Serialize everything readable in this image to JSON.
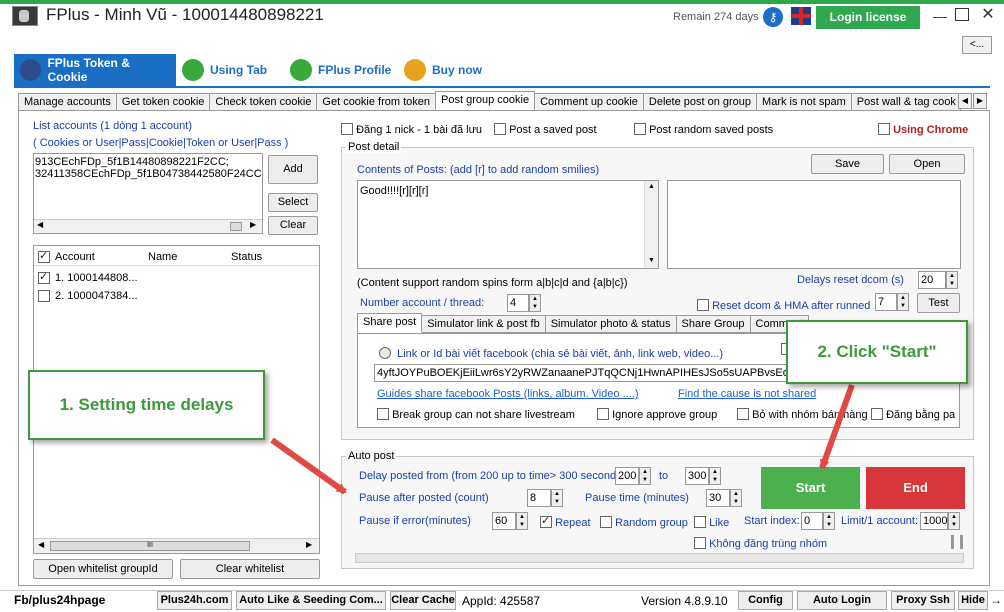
{
  "window": {
    "title": "FPlus - Minh Vũ - 100014480898221",
    "remain": "Remain 274 days",
    "login_label": "Login license",
    "back_label": "<..."
  },
  "main_tabs": [
    {
      "label": "FPlus Token & Cookie"
    },
    {
      "label": "Using Tab"
    },
    {
      "label": "FPlus Profile"
    },
    {
      "label": "Buy now"
    }
  ],
  "sub_tabs": [
    "Manage accounts",
    "Get token cookie",
    "Check token cookie",
    "Get cookie from token",
    "Post group cookie",
    "Comment up cookie",
    "Delete post on group",
    "Mark is not spam",
    "Post wall & tag cook"
  ],
  "left": {
    "list_title": "List accounts (1 dòng 1 account)",
    "list_hint": "( Cookies or User|Pass|Cookie|Token or User|Pass )",
    "cookie_lines": [
      "913CEchFDp_5f1B14480898221F2CC;",
      "32411358CEchFDp_5f1B04738442580F24CC;"
    ],
    "add_label": "Add",
    "select_label": "Select",
    "clear_label": "Clear",
    "columns": [
      "Account",
      "Name",
      "Status"
    ],
    "rows": [
      {
        "account": "1. 1000144808...",
        "checked": true
      },
      {
        "account": "2. 1000047384...",
        "checked": false
      }
    ],
    "whitelist_label": "Open whitelist groupId",
    "clear_whitelist_label": "Clear whitelist"
  },
  "options": {
    "one_nick": "Đăng 1 nick - 1 bài đã lưu",
    "saved_post": "Post a saved post",
    "random_saved": "Post random saved posts",
    "using_chrome": "Using Chrome"
  },
  "post_detail": {
    "label": "Post detail",
    "contents_label": "Contents of Posts: (add [r] to add random smilies)",
    "save_label": "Save",
    "open_label": "Open",
    "content_text": "Good!!!![r][r][r]",
    "spin_hint": "(Content support random spins form a|b|c|d and {a|b|c})",
    "delays_reset_label": "Delays reset dcom (s)",
    "delays_reset_value": "20",
    "number_account_label": "Number account / thread:",
    "number_account_value": "4",
    "reset_dcom_label": "Reset dcom & HMA after runned",
    "reset_dcom_value": "7",
    "test_label": "Test"
  },
  "inner_tabs": [
    "Share post",
    "Simulator link & post fb",
    "Simulator photo & status",
    "Share Group",
    "Comment"
  ],
  "share": {
    "link_label": "Link or Id bài viết facebook (chia sẻ bài viết, ảnh, link web, video...)",
    "token_value": "4yftJOYPuBOEKjEiiLwr6sY2yRWZanaanePJTqQCNj1HwnAPIHEsJSo5sUAPBvsEoN...",
    "guides_link": "Guides share facebook Posts (links, album. Video ....)",
    "cause_link": "Find the cause is not shared",
    "break_group": "Break group can not share livestream",
    "ignore_approve": "Ignore approve group",
    "bo_nhom": "Bỏ with nhóm bán hàng",
    "dang_bang": "Đăng bằng pa"
  },
  "auto_post": {
    "label": "Auto post",
    "delay_label": "Delay posted from (from 200 up to time> 300 seconds)",
    "delay_from": "200",
    "to_label": "to",
    "delay_to": "300",
    "pause_after_label": "Pause after posted (count)",
    "pause_after_value": "8",
    "pause_time_label": "Pause time (minutes)",
    "pause_time_value": "30",
    "pause_error_label": "Pause if error(minutes)",
    "pause_error_value": "60",
    "repeat_label": "Repeat",
    "random_group_label": "Random group",
    "like_label": "Like",
    "start_index_label": "Start index:",
    "start_index_value": "0",
    "limit_label": "Limit/1 account:",
    "limit_value": "1000",
    "no_dup_label": "Không đăng trùng nhóm",
    "start_label": "Start",
    "end_label": "End"
  },
  "callouts": {
    "one": "1. Setting time delays",
    "two": "2. Click \"Start\""
  },
  "status": {
    "fb": "Fb/plus24hpage",
    "plus24h": "Plus24h.com",
    "auto_like": "Auto Like & Seeding Com...",
    "clear_cache": "Clear Cache",
    "app_id": "AppId: 425587",
    "version": "Version 4.8.9.10",
    "config": "Config",
    "auto_login": "Auto Login",
    "proxy": "Proxy Ssh",
    "hide": "Hide",
    "hide_arrow": "→"
  },
  "colors": {
    "accent": "#1a6fc4",
    "green": "#4caf50",
    "red": "#d7373b",
    "callout": "#3c9a3c"
  }
}
